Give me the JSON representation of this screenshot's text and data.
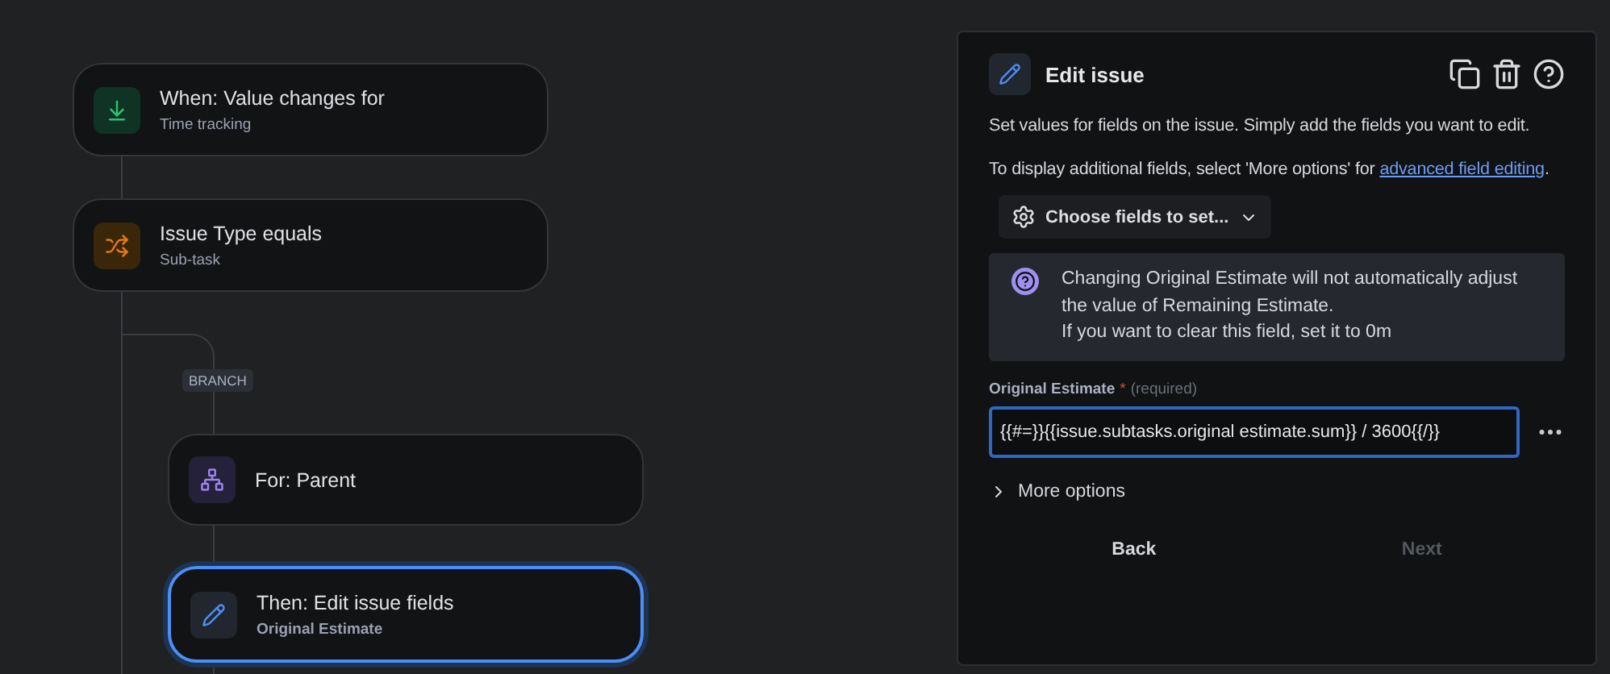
{
  "canvas": {
    "nodes": [
      {
        "kind": "trigger",
        "title": "When: Value changes for",
        "subtitle": "Time tracking",
        "selected": false
      },
      {
        "kind": "condition",
        "title": "Issue Type equals",
        "subtitle": "Sub-task",
        "selected": false
      },
      {
        "kind": "branch",
        "title": "For: Parent",
        "selected": false
      },
      {
        "kind": "action",
        "title": "Then: Edit issue fields",
        "subtitle": "Original Estimate",
        "selected": true
      }
    ],
    "branch_label": "BRANCH"
  },
  "panel": {
    "title": "Edit issue",
    "description": "Set values for fields on the issue. Simply add the fields you want to edit.",
    "hint": "To display additional fields, select 'More options' for ",
    "hint_link": "advanced field editing",
    "hint_end": ".",
    "choose_button": "Choose fields to set...",
    "notice_lines": [
      "Changing Original Estimate will not automatically adjust the value of Remaining Estimate.",
      "If you want to clear this field, set it to 0m"
    ],
    "field": {
      "label": "Original Estimate",
      "required_mark": "*",
      "required_note": "(required)",
      "value": "{{#=}}{{issue.subtasks.original estimate.sum}} / 3600{{/}}",
      "focused": true
    },
    "more_options": "More options",
    "buttons": [
      {
        "label": "Back",
        "disabled": false
      },
      {
        "label": "Next",
        "disabled": true
      }
    ]
  }
}
